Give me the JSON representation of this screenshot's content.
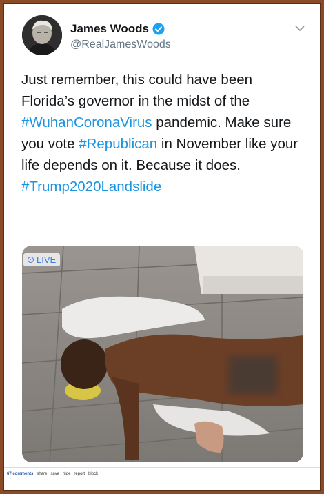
{
  "tweet": {
    "author_name": "James Woods",
    "author_handle": "@RealJamesWoods",
    "text_parts": [
      "Just remember, this could have been Florida’s governor in the midst of the ",
      "#WuhanCoronaVirus",
      " pandemic. Make sure you vote ",
      "#Republican",
      " in November like your life depends on it. Because it does. ",
      "#Trump2020Landslide"
    ],
    "live_badge": "LIVE",
    "icons": {
      "verified": "verified-badge-icon",
      "caret": "chevron-down-icon",
      "live": "live-icon"
    }
  },
  "footer": {
    "comments": "67 comments",
    "links": [
      "share",
      "save",
      "hide",
      "report",
      "block"
    ]
  },
  "colors": {
    "frame": "#8a4a26",
    "link": "#1b95e0",
    "text": "#14171a",
    "muted": "#657786"
  }
}
